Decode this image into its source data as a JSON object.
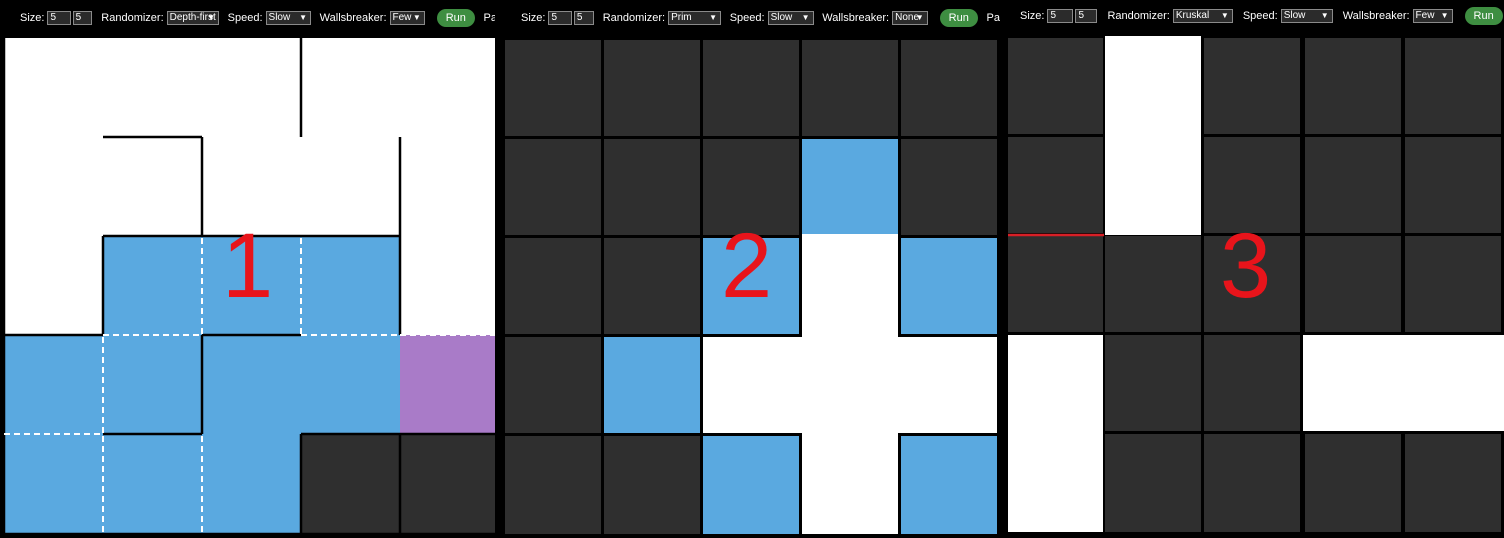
{
  "panels": [
    {
      "label": "1",
      "toolbar": {
        "size_label": "Size:",
        "size_w": "5",
        "size_h": "5",
        "randomizer_label": "Randomizer:",
        "randomizer_value": "Depth-first",
        "speed_label": "Speed:",
        "speed_value": "Slow",
        "wallsbreaker_label": "Wallsbreaker:",
        "wallsbreaker_value": "Few",
        "run_label": "Run",
        "trailing_text": "Pa"
      }
    },
    {
      "label": "2",
      "toolbar": {
        "size_label": "Size:",
        "size_w": "5",
        "size_h": "5",
        "randomizer_label": "Randomizer:",
        "randomizer_value": "Prim",
        "speed_label": "Speed:",
        "speed_value": "Slow",
        "wallsbreaker_label": "Wallsbreaker:",
        "wallsbreaker_value": "None",
        "run_label": "Run",
        "trailing_text": "Pa"
      }
    },
    {
      "label": "3",
      "toolbar": {
        "size_label": "Size:",
        "size_w": "5",
        "size_h": "5",
        "randomizer_label": "Randomizer:",
        "randomizer_value": "Kruskal",
        "speed_label": "Speed:",
        "speed_value": "Slow",
        "wallsbreaker_label": "Wallsbreaker:",
        "wallsbreaker_value": "Few",
        "run_label": "Run"
      }
    }
  ],
  "colors": {
    "open": "#ffffff",
    "unvisited": "#2f2f2f",
    "visited": "#5aa9e0",
    "current": "#a97bc8",
    "wall": "#000000",
    "highlight_wall": "#d81f26",
    "run_button": "#3e8e41"
  }
}
